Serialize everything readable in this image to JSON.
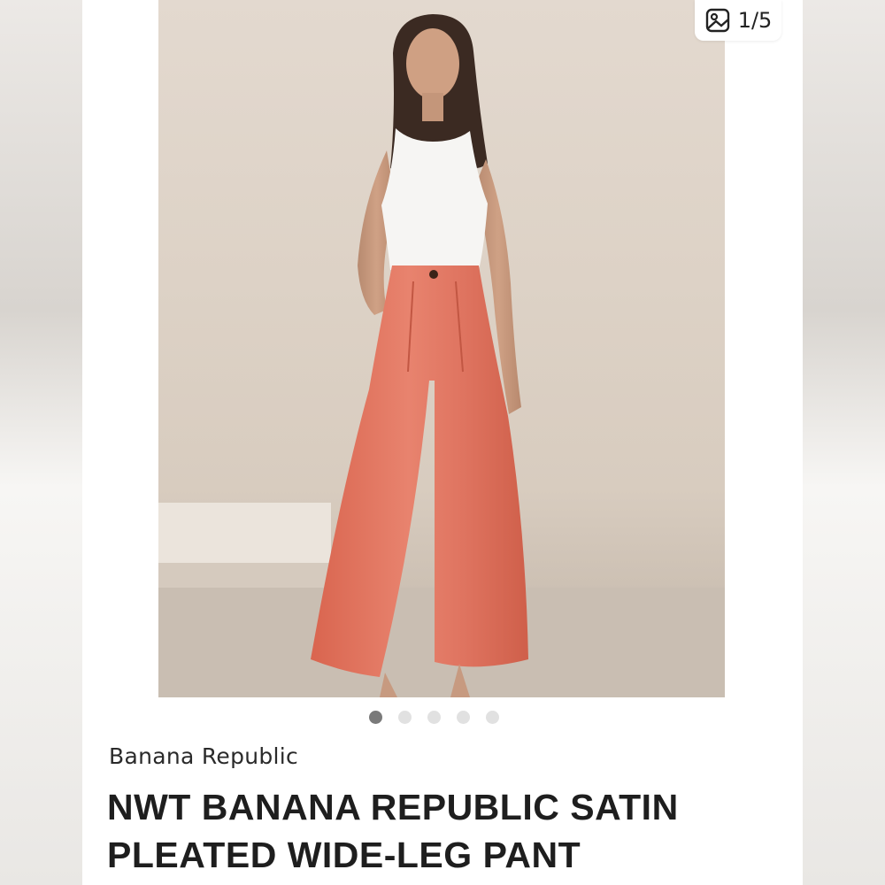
{
  "listing": {
    "image_counter": "1/5",
    "image_index": 1,
    "image_total": 5,
    "brand": "Banana Republic",
    "title": "NWT BANANA REPUBLIC SATIN PLEATED WIDE-LEG PANT"
  },
  "icons": {
    "counter": "gallery-icon"
  },
  "colors": {
    "pant": "#df7460",
    "backdrop": "#ddd2c6",
    "dot_active": "#7a7a7a",
    "dot_inactive": "#e1e1e1"
  }
}
